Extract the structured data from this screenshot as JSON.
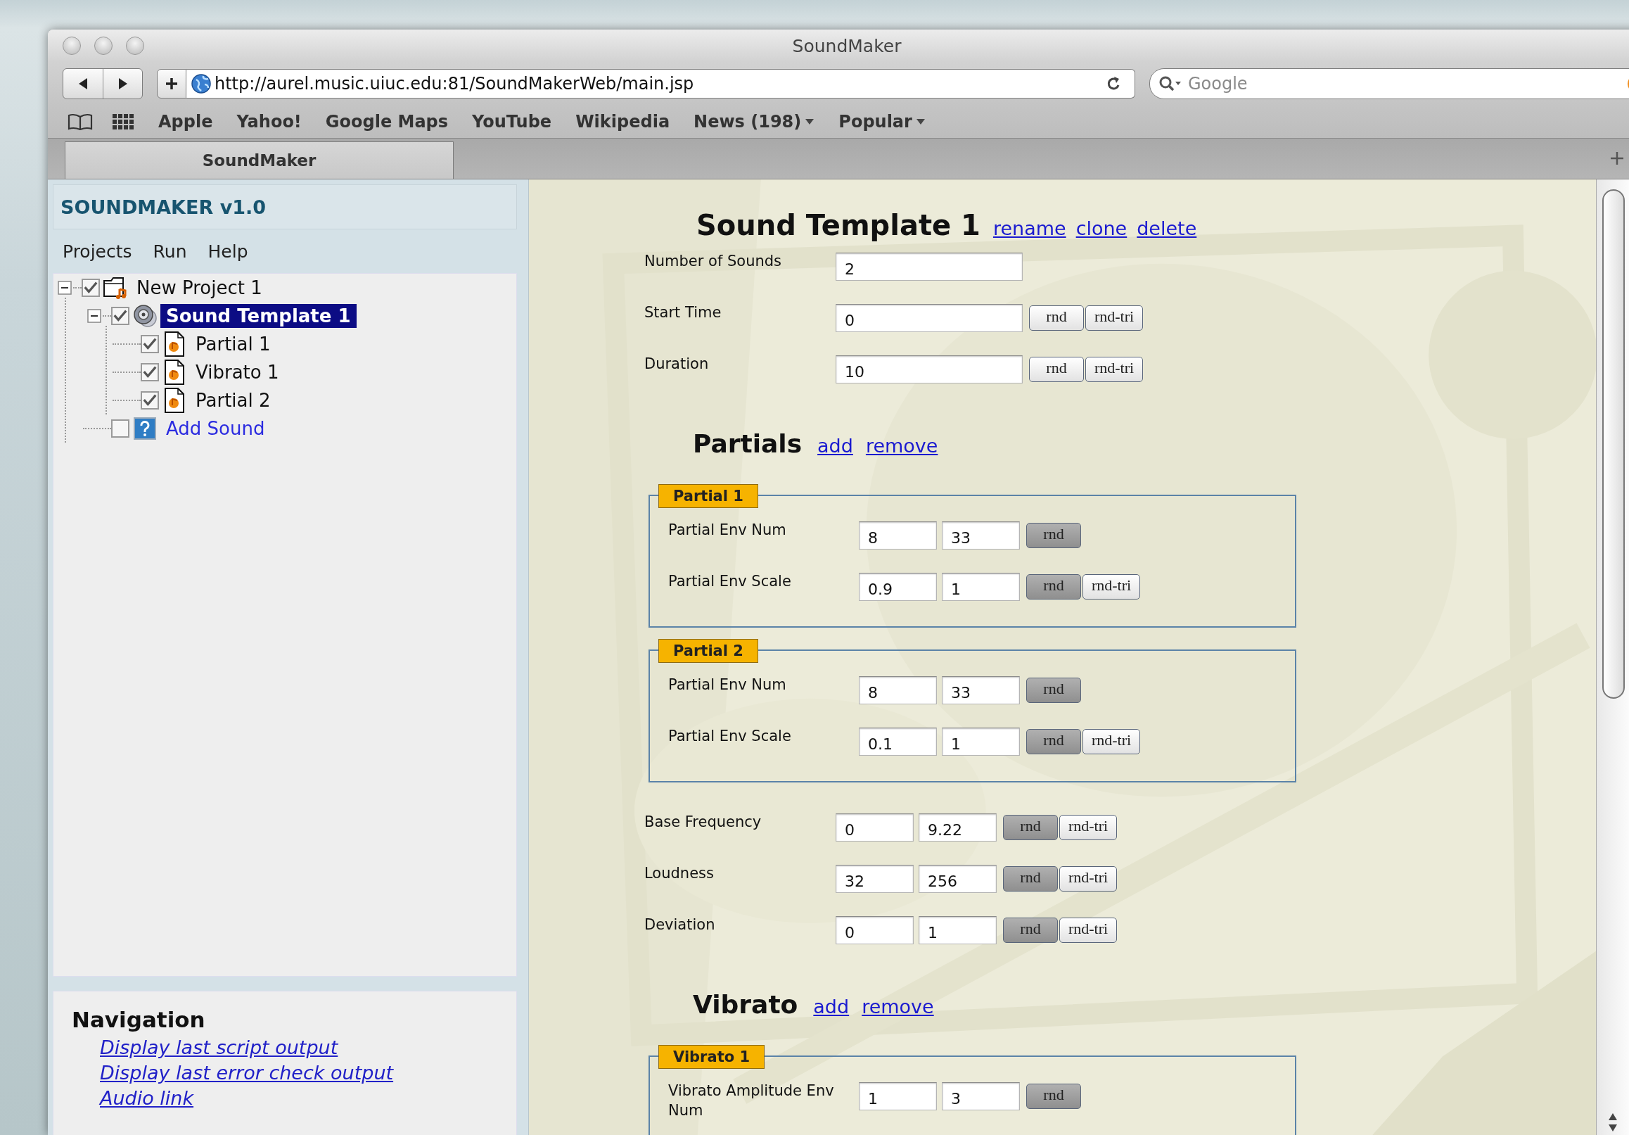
{
  "window": {
    "title": "SoundMaker"
  },
  "toolbar": {
    "url": "http://aurel.music.uiuc.edu:81/SoundMakerWeb/main.jsp",
    "search": {
      "placeholder": "Google"
    }
  },
  "bookmarks": [
    {
      "label": "Apple",
      "menu": false
    },
    {
      "label": "Yahoo!",
      "menu": false
    },
    {
      "label": "Google Maps",
      "menu": false
    },
    {
      "label": "YouTube",
      "menu": false
    },
    {
      "label": "Wikipedia",
      "menu": false
    },
    {
      "label": "News (198)",
      "menu": true
    },
    {
      "label": "Popular",
      "menu": true
    }
  ],
  "tabs": [
    {
      "label": "SoundMaker",
      "selected": true
    }
  ],
  "sidebar": {
    "title": "SOUNDMAKER v1.0",
    "menu": [
      "Projects",
      "Run",
      "Help"
    ],
    "tree": [
      {
        "label": "New Project 1",
        "kind": "project",
        "checked": true,
        "expanded": true,
        "selected": false,
        "children": [
          {
            "label": "Sound Template 1",
            "kind": "sound",
            "checked": true,
            "expanded": true,
            "selected": true,
            "children": [
              {
                "label": "Partial 1",
                "kind": "file",
                "checked": true,
                "selected": false
              },
              {
                "label": "Vibrato 1",
                "kind": "file",
                "checked": true,
                "selected": false
              },
              {
                "label": "Partial 2",
                "kind": "file",
                "checked": true,
                "selected": false
              }
            ]
          },
          {
            "label": "Add Sound",
            "kind": "add",
            "checked": false,
            "selected": false
          }
        ]
      }
    ]
  },
  "navigation": {
    "title": "Navigation",
    "links": [
      "Display last script output",
      "Display last error check output",
      "Audio link"
    ]
  },
  "form": {
    "title": "Sound Template 1",
    "actions": [
      "rename",
      "clone",
      "delete"
    ],
    "blocks": [
      {
        "kind": "field",
        "label": "Number of Sounds",
        "values": [
          "2"
        ]
      },
      {
        "kind": "field",
        "label": "Start Time",
        "values": [
          "0"
        ],
        "buttons": [
          {
            "label": "rnd",
            "pressed": false
          },
          {
            "label": "rnd-tri",
            "pressed": false
          }
        ]
      },
      {
        "kind": "field",
        "label": "Duration",
        "values": [
          "10"
        ],
        "buttons": [
          {
            "label": "rnd",
            "pressed": false
          },
          {
            "label": "rnd-tri",
            "pressed": false
          }
        ]
      },
      {
        "kind": "heading",
        "title": "Partials",
        "actions": [
          "add",
          "remove"
        ]
      },
      {
        "kind": "group",
        "legend": "Partial 1",
        "fields": [
          {
            "label": "Partial Env Num",
            "values": [
              "8",
              "33"
            ],
            "buttons": [
              {
                "label": "rnd",
                "pressed": true
              }
            ]
          },
          {
            "label": "Partial Env Scale",
            "values": [
              "0.9",
              "1"
            ],
            "buttons": [
              {
                "label": "rnd",
                "pressed": true
              },
              {
                "label": "rnd-tri",
                "pressed": false
              }
            ]
          }
        ]
      },
      {
        "kind": "group",
        "legend": "Partial 2",
        "fields": [
          {
            "label": "Partial Env Num",
            "values": [
              "8",
              "33"
            ],
            "buttons": [
              {
                "label": "rnd",
                "pressed": true
              }
            ]
          },
          {
            "label": "Partial Env Scale",
            "values": [
              "0.1",
              "1"
            ],
            "buttons": [
              {
                "label": "rnd",
                "pressed": true
              },
              {
                "label": "rnd-tri",
                "pressed": false
              }
            ]
          }
        ]
      },
      {
        "kind": "field",
        "label": "Base Frequency",
        "values": [
          "0",
          "9.22"
        ],
        "buttons": [
          {
            "label": "rnd",
            "pressed": true
          },
          {
            "label": "rnd-tri",
            "pressed": false
          }
        ]
      },
      {
        "kind": "field",
        "label": "Loudness",
        "values": [
          "32",
          "256"
        ],
        "buttons": [
          {
            "label": "rnd",
            "pressed": true
          },
          {
            "label": "rnd-tri",
            "pressed": false
          }
        ]
      },
      {
        "kind": "field",
        "label": "Deviation",
        "values": [
          "0",
          "1"
        ],
        "buttons": [
          {
            "label": "rnd",
            "pressed": true
          },
          {
            "label": "rnd-tri",
            "pressed": false
          }
        ]
      },
      {
        "kind": "heading",
        "title": "Vibrato",
        "actions": [
          "add",
          "remove"
        ]
      },
      {
        "kind": "group",
        "legend": "Vibrato 1",
        "fields": [
          {
            "label": "Vibrato Amplitude Env Num",
            "values": [
              "1",
              "3"
            ],
            "buttons": [
              {
                "label": "rnd",
                "pressed": true
              }
            ]
          }
        ]
      }
    ]
  }
}
